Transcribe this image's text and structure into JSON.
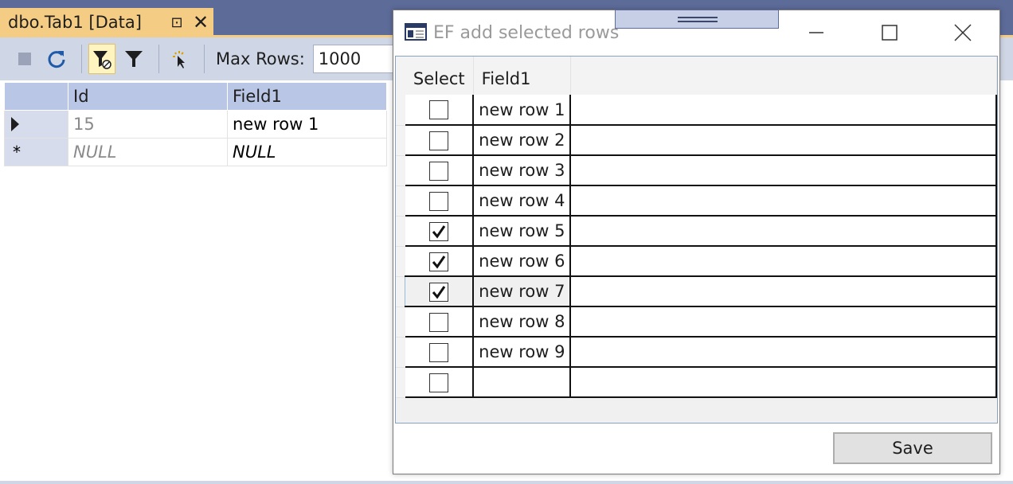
{
  "doc_tab": {
    "title": "dbo.Tab1 [Data]",
    "pin_glyph": "⊡",
    "close_glyph": "✕"
  },
  "toolbar": {
    "max_rows_label": "Max Rows:",
    "max_rows_value": "1000",
    "icons": [
      "stop-icon",
      "refresh-icon",
      "filter-active-icon",
      "filter-icon",
      "cursor-icon"
    ]
  },
  "data_grid": {
    "columns": [
      "Id",
      "Field1"
    ],
    "rows": [
      {
        "marker": "current",
        "id": "15",
        "field1": "new row 1"
      },
      {
        "marker": "*",
        "id": "NULL",
        "field1": "NULL"
      }
    ]
  },
  "dialog": {
    "title": "EF add selected rows",
    "columns": {
      "select": "Select",
      "field1": "Field1"
    },
    "rows": [
      {
        "checked": false,
        "field1": "new row 1"
      },
      {
        "checked": false,
        "field1": "new row 2"
      },
      {
        "checked": false,
        "field1": "new row 3"
      },
      {
        "checked": false,
        "field1": "new row 4"
      },
      {
        "checked": true,
        "field1": "new row 5"
      },
      {
        "checked": true,
        "field1": "new row 6"
      },
      {
        "checked": true,
        "field1": "new row 7",
        "current": true
      },
      {
        "checked": false,
        "field1": "new row 8"
      },
      {
        "checked": false,
        "field1": "new row 9"
      },
      {
        "checked": false,
        "field1": ""
      }
    ],
    "save_label": "Save"
  },
  "colors": {
    "accent_tab": "#f5cc84",
    "toolbar_bg": "#cfd6e5",
    "frame": "#5d6b99"
  }
}
